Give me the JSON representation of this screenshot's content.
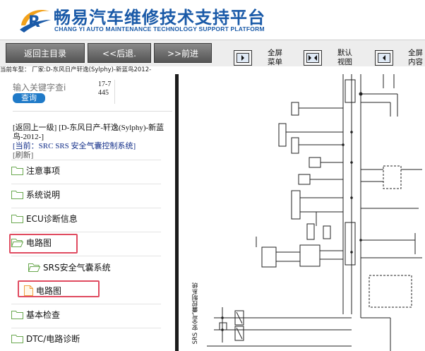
{
  "header": {
    "title_cn": "畅易汽车维修技术支持平台",
    "title_en": "CHANG YI AUTO MAINTENANCE TECHNOLOGY SUPPORT PLATFORM",
    "brand_color": "#1a5aa8"
  },
  "toolbar": {
    "home_label": "返回主目录",
    "back_label": "<<后退.",
    "forward_label": ">>前进",
    "fullscreen_menu_label": [
      "全屏",
      "菜单"
    ],
    "default_view_label": [
      "默认",
      "视图"
    ],
    "fullscreen_content_label": [
      "全屏",
      "内容"
    ]
  },
  "vehicle": {
    "text": "当前车型：  厂家:D-东风日产轩逸(Sylphy)-新蓝鸟2012-"
  },
  "search": {
    "placeholder": "输入关键字查i",
    "code": "17-7445",
    "button_label": "查询"
  },
  "breadcrumb": {
    "back_link": "[返回上一级]",
    "parent": "[D-东风日产-轩逸(Sylphy)-新蓝鸟-2012-]",
    "current": "[当前：SRC SRS 安全气囊控制系统]",
    "refresh": "[刷新]"
  },
  "tree": {
    "items": [
      {
        "label": "注意事项",
        "type": "folder"
      },
      {
        "label": "系统说明",
        "type": "folder"
      },
      {
        "label": "ECU诊断信息",
        "type": "folder"
      },
      {
        "label": "电路图",
        "type": "folder-open"
      },
      {
        "label": "SRS安全气囊系统",
        "type": "folder-open"
      },
      {
        "label": "电路图",
        "type": "file"
      },
      {
        "label": "基本检查",
        "type": "folder"
      },
      {
        "label": "DTC/电路诊断",
        "type": "folder"
      }
    ],
    "highlight_color": "#e04b60",
    "folder_color": "#6aa84f"
  },
  "diagram": {
    "vertical_title": "SRS 安全气囊控制系统"
  }
}
